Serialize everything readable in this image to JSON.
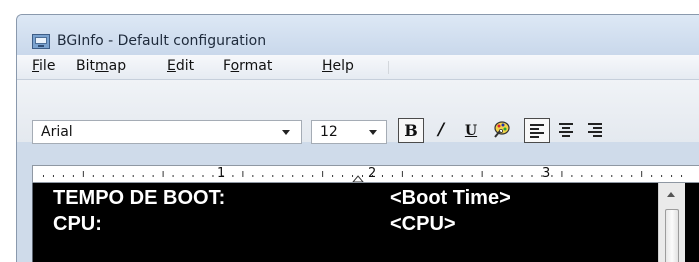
{
  "window": {
    "title": "BGInfo - Default configuration",
    "icon": "bginfo-monitor-icon"
  },
  "menubar": {
    "items": [
      {
        "prefix": "",
        "accel": "F",
        "suffix": "ile"
      },
      {
        "prefix": "Bit",
        "accel": "m",
        "suffix": "ap"
      },
      {
        "prefix": "",
        "accel": "E",
        "suffix": "dit"
      },
      {
        "prefix": "F",
        "accel": "o",
        "suffix": "rmat"
      },
      {
        "prefix": "",
        "accel": "H",
        "suffix": "elp"
      }
    ]
  },
  "toolbar": {
    "font_name": "Arial",
    "font_size": "12",
    "bold_glyph": "B",
    "italic_glyph": "/",
    "underline_glyph": "U",
    "bold_pressed": true,
    "align_left_pressed": true,
    "icons": [
      "bold-icon",
      "italic-icon",
      "underline-icon",
      "color-palette-icon",
      "align-left-icon",
      "align-center-icon",
      "align-right-icon"
    ]
  },
  "ruler": {
    "numbers": [
      "1",
      "2",
      "3"
    ]
  },
  "editor": {
    "lines": [
      {
        "label": "TEMPO DE BOOT:",
        "value": "<Boot Time>"
      },
      {
        "label": "CPU:",
        "value": "<CPU>"
      }
    ],
    "background": "#000000",
    "text_color": "#ffffff"
  }
}
